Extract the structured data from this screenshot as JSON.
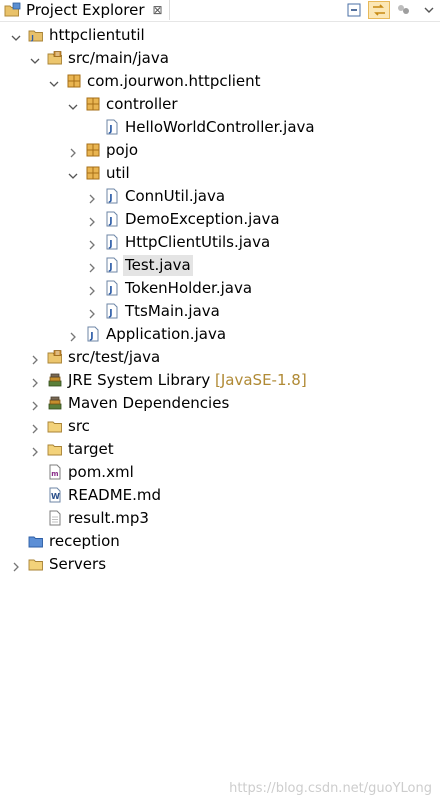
{
  "view": {
    "tab_title": "Project Explorer",
    "tab_close_glyph": "⊠",
    "toolbar": [
      "collapse-all-icon",
      "link-with-editor-icon",
      "select-working-set-icon",
      "view-menu-icon"
    ]
  },
  "tree": [
    {
      "label": "httpclientutil",
      "icon": "java-project-icon",
      "expanded": true
    },
    {
      "label": "src/main/java",
      "icon": "source-folder-icon",
      "expanded": true
    },
    {
      "label": "com.jourwon.httpclient",
      "icon": "package-icon",
      "expanded": true
    },
    {
      "label": "controller",
      "icon": "package-icon",
      "expanded": true
    },
    {
      "label": "HelloWorldController.java",
      "icon": "java-file-icon"
    },
    {
      "label": "pojo",
      "icon": "package-icon"
    },
    {
      "label": "util",
      "icon": "package-icon",
      "expanded": true
    },
    {
      "label": "ConnUtil.java",
      "icon": "java-file-icon"
    },
    {
      "label": "DemoException.java",
      "icon": "java-file-icon"
    },
    {
      "label": "HttpClientUtils.java",
      "icon": "java-file-icon"
    },
    {
      "label": "Test.java",
      "icon": "java-file-icon",
      "selected": true
    },
    {
      "label": "TokenHolder.java",
      "icon": "java-file-icon"
    },
    {
      "label": "TtsMain.java",
      "icon": "java-file-icon"
    },
    {
      "label": "Application.java",
      "icon": "java-file-icon"
    },
    {
      "label": "src/test/java",
      "icon": "source-folder-icon"
    },
    {
      "label": "JRE System Library",
      "decoration": "[JavaSE-1.8]",
      "icon": "library-icon"
    },
    {
      "label": "Maven Dependencies",
      "icon": "library-icon"
    },
    {
      "label": "src",
      "icon": "folder-icon"
    },
    {
      "label": "target",
      "icon": "folder-icon"
    },
    {
      "label": "pom.xml",
      "icon": "xml-file-icon"
    },
    {
      "label": "README.md",
      "icon": "text-file-icon"
    },
    {
      "label": "result.mp3",
      "icon": "file-icon"
    },
    {
      "label": "reception",
      "icon": "closed-project-icon"
    },
    {
      "label": "Servers",
      "icon": "folder-icon"
    }
  ],
  "watermark": "https://blog.csdn.net/guoYLong"
}
